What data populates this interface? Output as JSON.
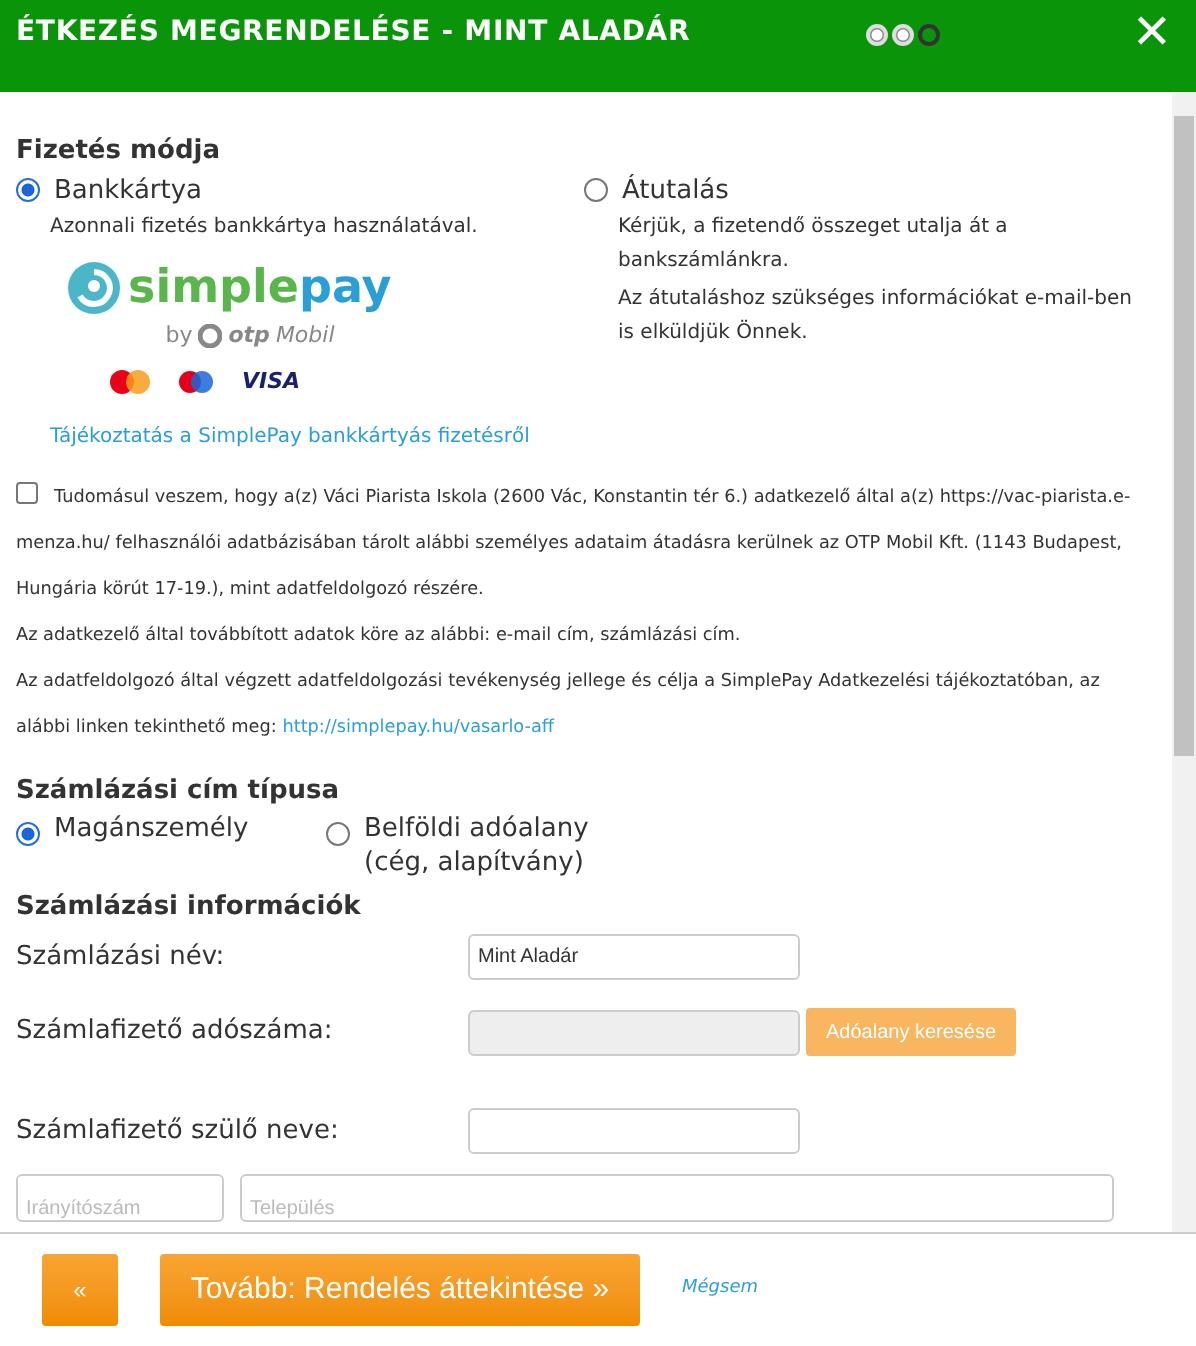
{
  "header": {
    "title": "ÉTKEZÉS MEGRENDELÉSE - MINT ALADÁR",
    "steps": [
      {
        "done": true
      },
      {
        "done": true
      },
      {
        "done": false
      }
    ],
    "close": "✕"
  },
  "payment": {
    "heading": "Fizetés módja",
    "options": [
      {
        "label": "Bankkártya",
        "selected": true,
        "lines": [
          "Azonnali fizetés bankkártya használatával."
        ],
        "kind": "card"
      },
      {
        "label": "Átutalás",
        "selected": false,
        "lines": [
          "Kérjük, a fizetendő összeget utalja át a bankszámlánkra.",
          "Az átutaláshoz szükséges információkat e-mail-ben is elküldjük Önnek."
        ],
        "kind": "plain"
      }
    ],
    "logo": {
      "simple": "simple",
      "pay": "pay",
      "by": "by",
      "otp": "otp",
      "mobil": "Mobil",
      "visa": "VISA"
    },
    "info_link": "Tájékoztatás a SimplePay bankkártyás fizetésről"
  },
  "consent": {
    "checked": false,
    "text": "Tudomásul veszem, hogy a(z) Váci Piarista Iskola (2600 Vác, Konstantin tér 6.) adatkezelő által a(z) https://vac-piarista.e-menza.hu/ felhasználói adatbázisában tárolt alábbi személyes adataim átadásra kerülnek az OTP Mobil Kft. (1143 Budapest, Hungária körút 17-19.), mint adatfeldolgozó részére.",
    "data_line": "Az adatkezelő által továbbított adatok köre az alábbi: e-mail cím, számlázási cím.",
    "purpose": "Az adatfeldolgozó által végzett adatfeldolgozási tevékenység jellege és célja a SimplePay Adatkezelési tájékoztatóban, az alábbi linken tekinthető meg:",
    "link": "http://simplepay.hu/vasarlo-aff"
  },
  "address_type": {
    "heading": "Számlázási cím típusa",
    "options": [
      {
        "label": "Magánszemély",
        "selected": true
      },
      {
        "label": "Belföldi adóalany\n(cég, alapítvány)",
        "selected": false
      }
    ]
  },
  "billing": {
    "heading": "Számlázási információk",
    "fields": [
      {
        "label": "Számlázási név:",
        "value": "Mint Aladár",
        "disabled": false
      },
      {
        "label": "Számlafizető adószáma:",
        "disabled": true,
        "button": "Adóalany keresése"
      },
      {
        "label": "Számlafizető szülő neve:",
        "disabled": false
      }
    ],
    "zip": {
      "placeholder": "Irányítószám"
    },
    "city": {
      "placeholder": "Település"
    }
  },
  "footer": {
    "back": "«",
    "next": "Tovább: Rendelés áttekintése »",
    "cancel": "Mégsem"
  }
}
